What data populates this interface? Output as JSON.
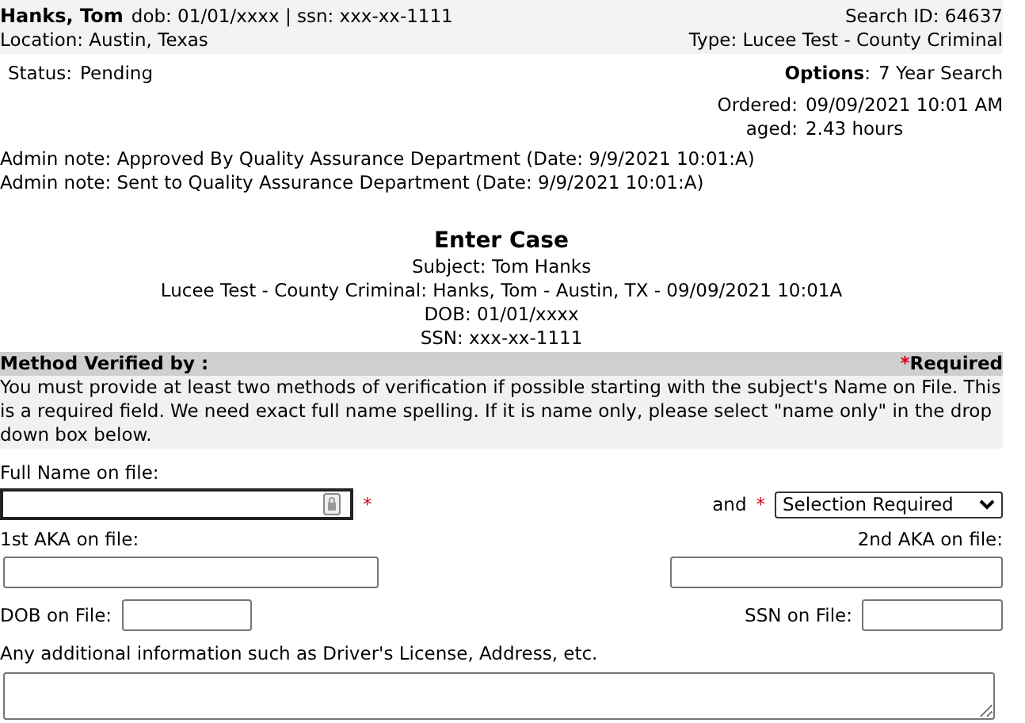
{
  "header": {
    "name": "Hanks, Tom",
    "details": "dob: 01/01/xxxx | ssn: xxx-xx-1111",
    "search_id": "Search ID: 64637",
    "location": "Location: Austin, Texas",
    "type": "Type: Lucee Test - County Criminal"
  },
  "status": {
    "label": "Status:",
    "value": "Pending"
  },
  "options": {
    "label": "Options",
    "colon": ":",
    "value": "7 Year Search"
  },
  "order_info": [
    {
      "label": "Ordered:",
      "value": "09/09/2021 10:01 AM"
    },
    {
      "label": "aged:",
      "value": "2.43 hours"
    }
  ],
  "admin_notes": [
    "Admin note: Approved By Quality Assurance Department (Date: 9/9/2021  10:01:A)",
    "Admin note: Sent to Quality Assurance Department (Date: 9/9/2021  10:01:A)"
  ],
  "case": {
    "title": "Enter Case",
    "lines": [
      "Subject: Tom Hanks",
      "Lucee Test - County Criminal: Hanks, Tom - Austin, TX - 09/09/2021 10:01A",
      "DOB: 01/01/xxxx",
      "SSN: xxx-xx-1111"
    ]
  },
  "method": {
    "title": "Method Verified by :",
    "required_mark": "*",
    "required": "Required",
    "instructions": "You must provide at least two methods of verification if possible starting with the subject's Name on File. This is a required field. We need exact full name spelling. If it is name only, please select \"name only\" in the drop down box below."
  },
  "form": {
    "full_name": {
      "label": "Full Name on file:",
      "required_mark": "*",
      "focused": true
    },
    "and_label": "and",
    "and_mark": "*",
    "selection": {
      "value": "Selection Required"
    },
    "aka1": {
      "label": "1st AKA on file:"
    },
    "aka2": {
      "label": "2nd AKA on file:"
    },
    "dob": {
      "label": "DOB on File:"
    },
    "ssn": {
      "label": "SSN on File:"
    },
    "additional": {
      "label": "Any additional information such as Driver's License, Address, etc."
    }
  }
}
